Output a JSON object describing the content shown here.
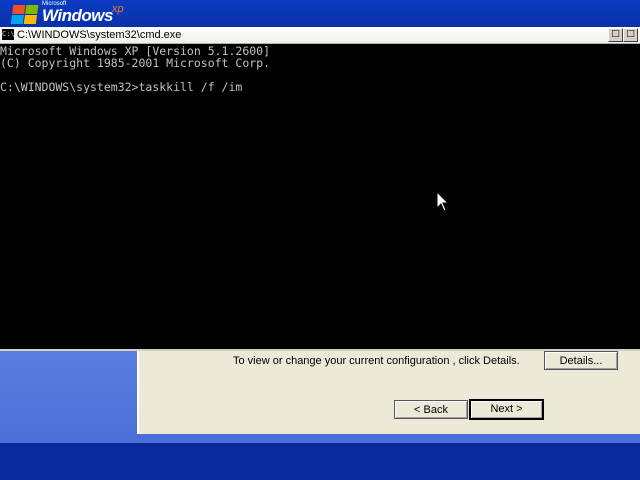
{
  "branding": {
    "microsoft": "Microsoft",
    "windows": "Windows",
    "xp": "xp"
  },
  "cmd": {
    "title": "C:\\WINDOWS\\system32\\cmd.exe",
    "lines": [
      "Microsoft Windows XP [Version 5.1.2600]",
      "(C) Copyright 1985-2001 Microsoft Corp.",
      "",
      "C:\\WINDOWS\\system32>taskkill /f /im"
    ]
  },
  "wizard": {
    "info_text": "To view or change your current configuration , click Details.",
    "details_label": "Details...",
    "back_label": "< Back",
    "next_label": "Next >"
  },
  "colors": {
    "desktop_blue": "#0a2a9e",
    "console_bg": "#000000",
    "console_text": "#c0c0c0",
    "panel_bg": "#ece9d8"
  },
  "icons": [
    "windows-flag-icon",
    "console-icon",
    "minimize-icon",
    "maximize-icon",
    "mouse-pointer-icon"
  ]
}
